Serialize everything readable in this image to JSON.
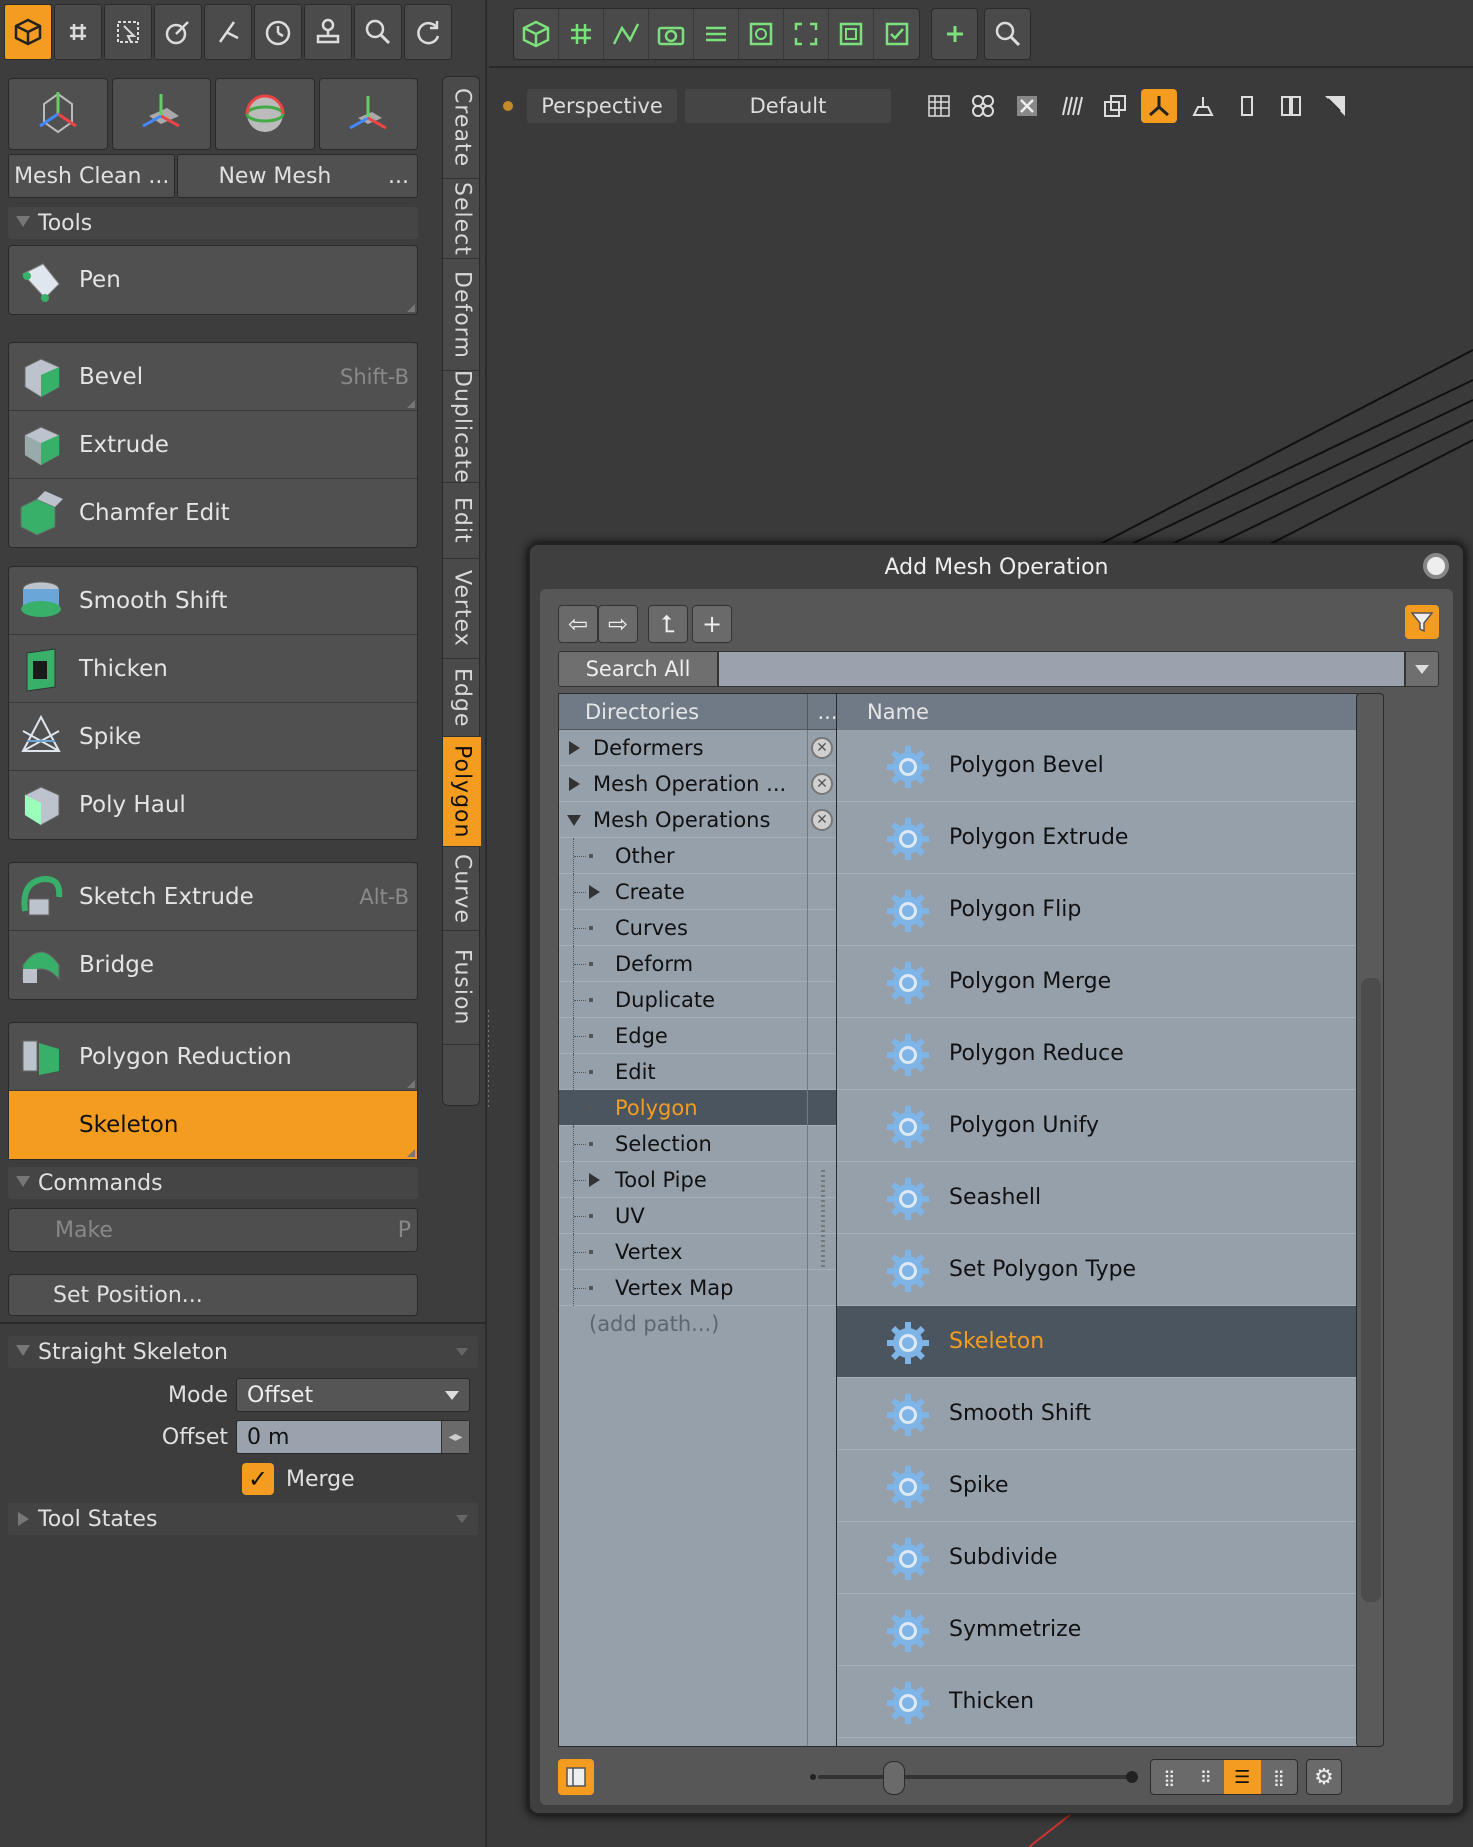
{
  "left": {
    "mesh_buttons": [
      "Mesh Clean ...",
      "New Mesh",
      "..."
    ],
    "tools_header": "Tools",
    "groups": [
      [
        {
          "label": "Pen",
          "shortcut": "",
          "icon": "pen-icon"
        }
      ],
      [
        {
          "label": "Bevel",
          "shortcut": "Shift-B",
          "icon": "bevel-icon"
        },
        {
          "label": "Extrude",
          "shortcut": "",
          "icon": "extrude-icon"
        },
        {
          "label": "Chamfer Edit",
          "shortcut": "",
          "icon": "chamfer-icon"
        }
      ],
      [
        {
          "label": "Smooth Shift",
          "shortcut": "",
          "icon": "smooth-shift-icon"
        },
        {
          "label": "Thicken",
          "shortcut": "",
          "icon": "thicken-icon"
        },
        {
          "label": "Spike",
          "shortcut": "",
          "icon": "spike-icon"
        },
        {
          "label": "Poly Haul",
          "shortcut": "",
          "icon": "poly-haul-icon"
        }
      ],
      [
        {
          "label": "Sketch Extrude",
          "shortcut": "Alt-B",
          "icon": "sketch-extrude-icon"
        },
        {
          "label": "Bridge",
          "shortcut": "",
          "icon": "bridge-icon"
        }
      ],
      [
        {
          "label": "Polygon Reduction",
          "shortcut": "",
          "icon": "polygon-reduction-icon"
        },
        {
          "label": "Skeleton",
          "shortcut": "",
          "icon": "",
          "active": true
        }
      ]
    ],
    "commands_header": "Commands",
    "make_label": "Make",
    "make_shortcut": "P",
    "set_position": "Set Position...",
    "straight_skeleton": "Straight Skeleton",
    "mode_label": "Mode",
    "mode_value": "Offset",
    "offset_label": "Offset",
    "offset_value": "0 m",
    "merge_label": "Merge",
    "merge_checked": true,
    "tool_states": "Tool States",
    "vertical_tabs": [
      "Create",
      "Select",
      "Deform",
      "Duplicate",
      "Edit",
      "Vertex",
      "Edge",
      "Polygon",
      "Curve",
      "Fusion"
    ],
    "active_tab": "Polygon"
  },
  "viewport": {
    "view_label": "Perspective",
    "style_label": "Default"
  },
  "dialog": {
    "title": "Add Mesh Operation",
    "search_label": "Search All",
    "search_value": "",
    "directories_header": "Directories",
    "directories_more": "...",
    "name_header": "Name",
    "directories": [
      {
        "label": "Deformers",
        "expander": "right",
        "indent": 0,
        "close": true
      },
      {
        "label": "Mesh Operation ...",
        "expander": "right",
        "indent": 0,
        "close": true
      },
      {
        "label": "Mesh Operations",
        "expander": "down",
        "indent": 0,
        "close": true
      },
      {
        "label": "Other",
        "indent": 1
      },
      {
        "label": "Create",
        "expander": "right",
        "indent": 1
      },
      {
        "label": "Curves",
        "indent": 1
      },
      {
        "label": "Deform",
        "indent": 1
      },
      {
        "label": "Duplicate",
        "indent": 1
      },
      {
        "label": "Edge",
        "indent": 1
      },
      {
        "label": "Edit",
        "indent": 1
      },
      {
        "label": "Polygon",
        "indent": 1,
        "selected": true
      },
      {
        "label": "Selection",
        "indent": 1
      },
      {
        "label": "Tool Pipe",
        "expander": "right",
        "indent": 1
      },
      {
        "label": "UV",
        "indent": 1
      },
      {
        "label": "Vertex",
        "indent": 1
      },
      {
        "label": "Vertex Map",
        "indent": 1
      }
    ],
    "add_path": "(add path...)",
    "items": [
      "Polygon Bevel",
      "Polygon Extrude",
      "Polygon Flip",
      "Polygon Merge",
      "Polygon Reduce",
      "Polygon Unify",
      "Seashell",
      "Set Polygon Type",
      "Skeleton",
      "Smooth Shift",
      "Spike",
      "Subdivide",
      "Symmetrize",
      "Thicken"
    ],
    "selected_item": "Skeleton"
  },
  "colors": {
    "accent": "#f39c1f",
    "list_bg": "#96a0ab",
    "selected_row": "#4b5560",
    "gear": "#7fb4e6"
  }
}
